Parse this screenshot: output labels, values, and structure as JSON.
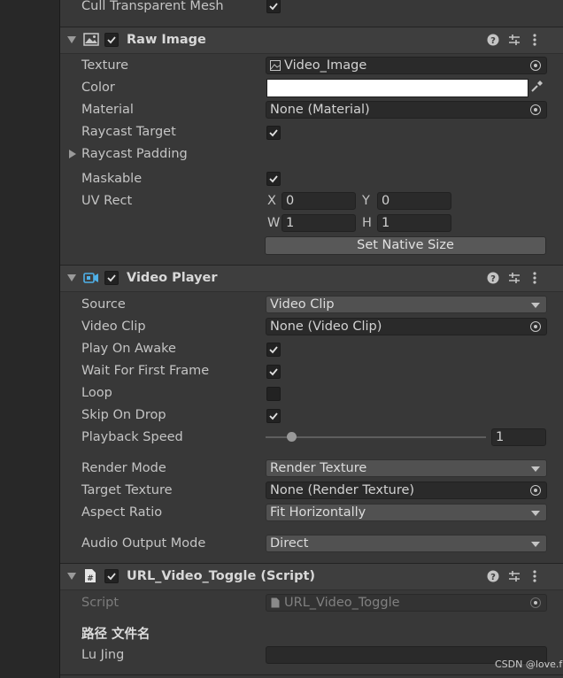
{
  "top": {
    "cull_label": "Cull Transparent Mesh"
  },
  "raw_image": {
    "title": "Raw Image",
    "texture_label": "Texture",
    "texture_value": "Video_Image",
    "color_label": "Color",
    "color_value": "#ffffff",
    "material_label": "Material",
    "material_value": "None (Material)",
    "raycast_target_label": "Raycast Target",
    "raycast_padding_label": "Raycast Padding",
    "maskable_label": "Maskable",
    "uv_rect_label": "UV Rect",
    "uv_x_label": "X",
    "uv_x": "0",
    "uv_y_label": "Y",
    "uv_y": "0",
    "uv_w_label": "W",
    "uv_w": "1",
    "uv_h_label": "H",
    "uv_h": "1",
    "native_size_button": "Set Native Size"
  },
  "video_player": {
    "title": "Video Player",
    "source_label": "Source",
    "source_value": "Video Clip",
    "video_clip_label": "Video Clip",
    "video_clip_value": "None (Video Clip)",
    "play_on_awake_label": "Play On Awake",
    "wait_first_frame_label": "Wait For First Frame",
    "loop_label": "Loop",
    "skip_on_drop_label": "Skip On Drop",
    "playback_speed_label": "Playback Speed",
    "playback_speed_value": "1",
    "render_mode_label": "Render Mode",
    "render_mode_value": "Render Texture",
    "target_texture_label": "Target Texture",
    "target_texture_value": "None (Render Texture)",
    "aspect_ratio_label": "Aspect Ratio",
    "aspect_ratio_value": "Fit Horizontally",
    "audio_output_label": "Audio Output Mode",
    "audio_output_value": "Direct"
  },
  "script_component": {
    "title": "URL_Video_Toggle (Script)",
    "script_label": "Script",
    "script_value": "URL_Video_Toggle",
    "section_header": "路径 文件名",
    "lu_jing_label": "Lu Jing",
    "lu_jing_value": ""
  },
  "watermark": "CSDN @love.f"
}
